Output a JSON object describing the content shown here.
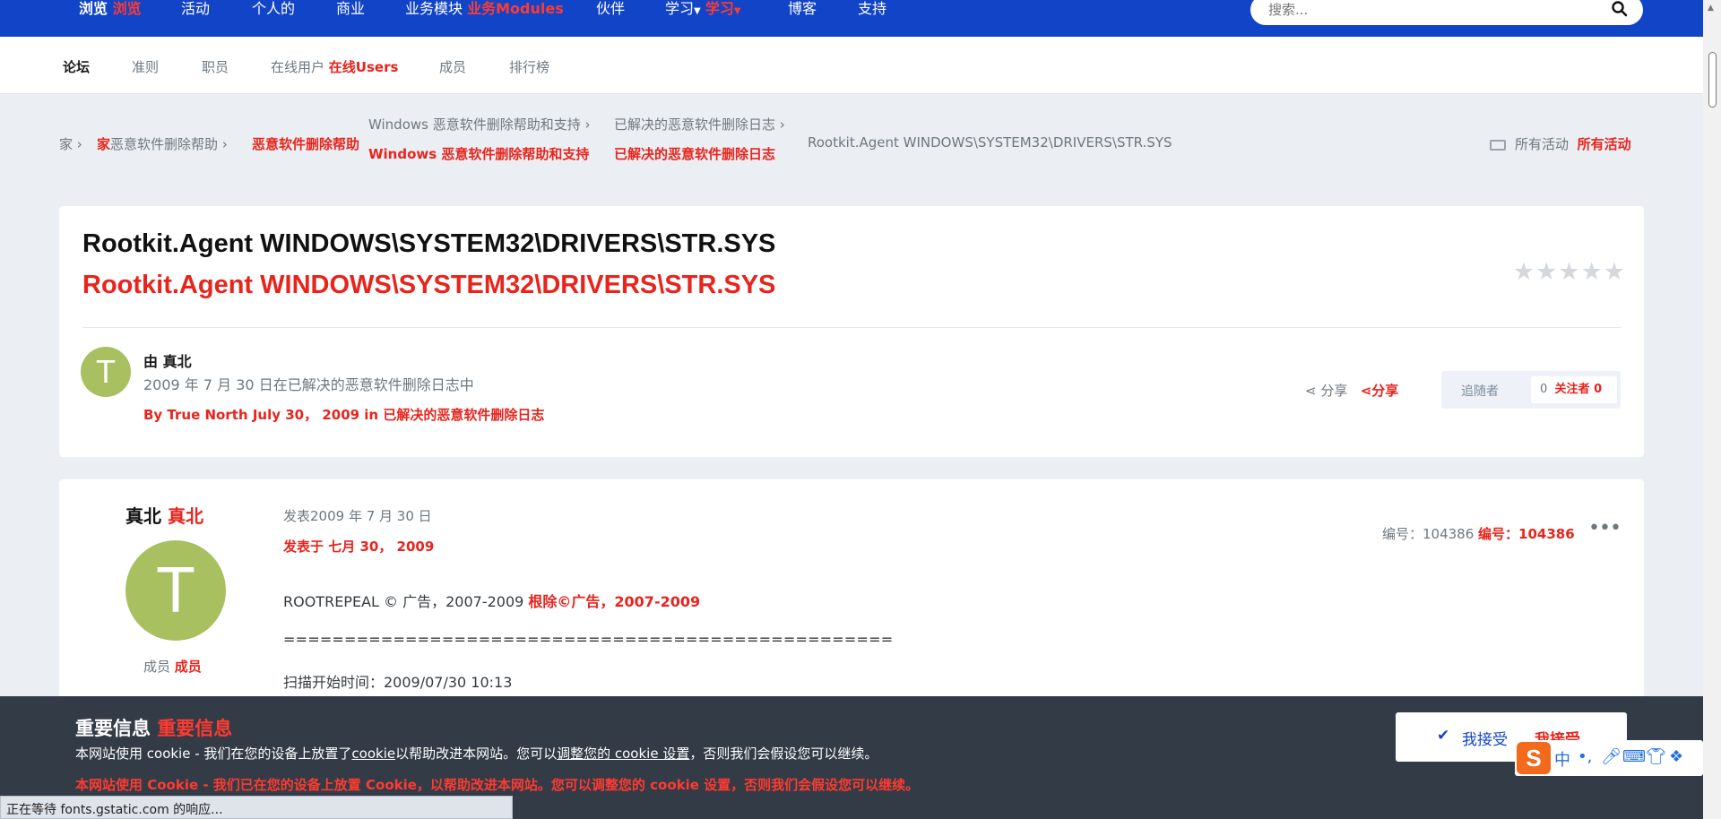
{
  "topnav": {
    "browse": "浏览",
    "browse_red": "浏览",
    "activity": "活动",
    "personal": "个人的",
    "business": "商业",
    "modules": "业务模块",
    "modules_red": "业务Modules",
    "partners": "伙伴",
    "learn": "学习",
    "learn_red": "学习",
    "blog": "博客",
    "support": "支持",
    "search_placeholder": "搜索..."
  },
  "subnav": {
    "forum": "论坛",
    "guidelines": "准则",
    "staff": "职员",
    "online_users": "在线用户",
    "online_users_red": "在线Users",
    "members": "成员",
    "leaderboard": "排行榜"
  },
  "breadcrumb": {
    "home": "家",
    "home_red": "家",
    "malware_help": "恶意软件删除帮助",
    "malware_help_red": "恶意软件删除帮助",
    "windows": "Windows 恶意软件删除帮助和支持",
    "windows_red": "Windows 恶意软件删除帮助和支持",
    "resolved": "已解决的恶意软件删除日志",
    "resolved_red": "已解决的恶意软件删除日志",
    "current": "Rootkit.Agent WINDOWS\\SYSTEM32\\DRIVERS\\STR.SYS",
    "all_activity": "所有活动",
    "all_activity_red": "所有活动"
  },
  "topic": {
    "title": "Rootkit.Agent WINDOWS\\SYSTEM32\\DRIVERS\\STR.SYS",
    "title_red": "Rootkit.Agent WINDOWS\\SYSTEM32\\DRIVERS\\STR.SYS",
    "avatar_letter": "T",
    "author": "由 真北",
    "date": "2009 年 7 月 30 日在已解决的恶意软件删除日志中",
    "date_red": "By True North July 30， 2009 in 已解决的恶意软件删除日志",
    "share": "分享",
    "share_red": "分享",
    "followers_label": "追随者",
    "followers_count": "0",
    "followers_red": "关注者 0",
    "rating_stars": 0
  },
  "post": {
    "username": "真北",
    "username_red": "真北",
    "avatar_letter": "T",
    "role": "成员",
    "role_red": "成员",
    "posted": "发表2009 年 7 月 30 日",
    "posted_red": "发表于 七月 30， 2009",
    "id_label": "编号：104386",
    "id_red": "编号：104386",
    "line1": "ROOTREPEAL © 广告，2007-2009",
    "line1_red": "根除©广告，2007-2009",
    "line2": "==================================================",
    "line3": "扫描开始时间：2009/07/30 10:13"
  },
  "cookie": {
    "title": "重要信息",
    "title_red": "重要信息",
    "text_a": "本网站使用 cookie - 我们在您的设备上放置了",
    "text_link1": "cookie",
    "text_b": "以帮助改进本网站。您可以",
    "text_link2": "调整您的 cookie 设置",
    "text_c": "，否则我们会假设您可以继续。",
    "text_red": "本网站使用 Cookie - 我们已在您的设备上放置 Cookie，以帮助改进本网站。您可以调整您的 cookie 设置，否则我们会假设您可以继续。",
    "accept": "我接受",
    "accept_red": "我接受"
  },
  "status_bar": "正在等待 fonts.gstatic.com 的响应...",
  "colors": {
    "nav_blue": "#1244c8",
    "accent_red": "#e8241d",
    "avatar_green": "#a8c060",
    "cookie_bg": "#333b47"
  }
}
